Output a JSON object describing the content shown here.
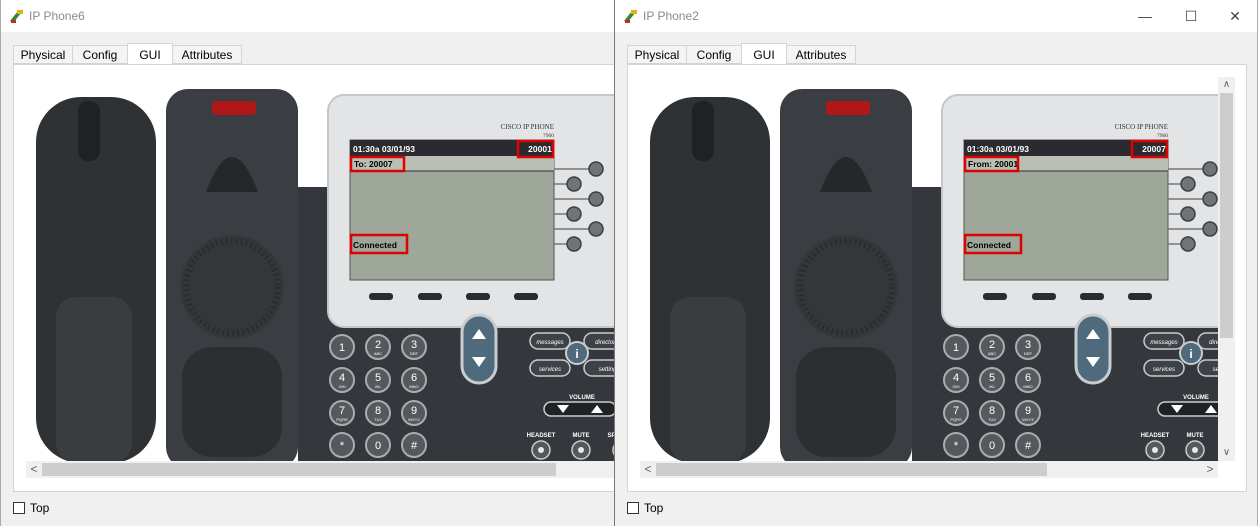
{
  "windows": [
    {
      "title": "IP Phone6",
      "tabs": [
        "Physical",
        "Config",
        "GUI",
        "Attributes"
      ],
      "selected_tab": "GUI",
      "show_window_controls": false,
      "phone": {
        "brand": "CISCO IP PHONE",
        "model": "7960",
        "lcd": {
          "datetime": "01:30a 03/01/93",
          "extension": "20001",
          "call_line": "To: 20007",
          "status": "Connected"
        }
      },
      "top_checkbox_label": "Top"
    },
    {
      "title": "IP Phone2",
      "tabs": [
        "Physical",
        "Config",
        "GUI",
        "Attributes"
      ],
      "selected_tab": "GUI",
      "show_window_controls": true,
      "phone": {
        "brand": "CISCO IP PHONE",
        "model": "7960",
        "lcd": {
          "datetime": "01:30a 03/01/93",
          "extension": "20007",
          "call_line": "From: 20001",
          "status": "Connected"
        }
      },
      "top_checkbox_label": "Top"
    }
  ],
  "keypad": [
    {
      "digit": "1",
      "letters": ""
    },
    {
      "digit": "2",
      "letters": "ABC"
    },
    {
      "digit": "3",
      "letters": "DEF"
    },
    {
      "digit": "4",
      "letters": "GHI"
    },
    {
      "digit": "5",
      "letters": "JKL"
    },
    {
      "digit": "6",
      "letters": "MNO"
    },
    {
      "digit": "7",
      "letters": "PQRS"
    },
    {
      "digit": "8",
      "letters": "TUV"
    },
    {
      "digit": "9",
      "letters": "WXYZ"
    },
    {
      "digit": "*",
      "letters": ""
    },
    {
      "digit": "0",
      "letters": ""
    },
    {
      "digit": "#",
      "letters": ""
    }
  ],
  "phone_labels": {
    "messages": "messages",
    "directories": "directories",
    "services": "services",
    "settings": "settings",
    "info": "i",
    "volume": "VOLUME",
    "headset": "HEADSET",
    "mute": "MUTE",
    "speaker": "SPEAKER"
  },
  "window_controls": {
    "minimize": "—",
    "maximize": "☐",
    "close": "✕"
  },
  "colors": {
    "highlight_box": "#e00000",
    "lcd_bg": "#9fa69a",
    "lcd_header": "#2a2a30",
    "phone_body": "#3a3e42",
    "handset": "#2f3235",
    "faceplate": "#e2e4e6",
    "nav_button": "#4f6a7c"
  }
}
